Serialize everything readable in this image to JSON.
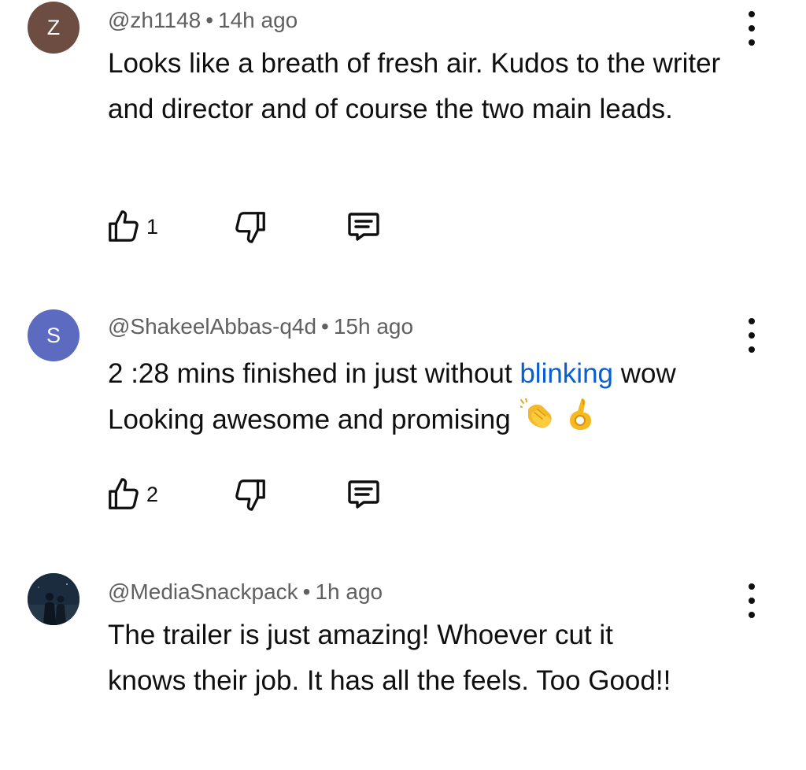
{
  "comments": [
    {
      "avatar_letter": "Z",
      "avatar_color": "#6d4c41",
      "handle": "@zh1148",
      "separator": "•",
      "time": "14h ago",
      "text": "Looks like a breath of fresh air. Kudos to the writer and director and of course the two main leads.",
      "like_count": "1"
    },
    {
      "avatar_letter": "S",
      "avatar_color": "#5c6bc0",
      "handle": "@ShakeelAbbas-q4d",
      "separator": "•",
      "time": "15h ago",
      "text_before_link": "2 :28 mins finished in just without ",
      "link_text": "blinking",
      "text_after_link": " wow Looking awesome and promising",
      "emojis": [
        "clapping-hands",
        "ok-hand"
      ],
      "like_count": "2"
    },
    {
      "avatar_letter": "",
      "avatar_color": "#1c2d3f",
      "handle": "@MediaSnackpack",
      "separator": "•",
      "time": "1h ago",
      "text": "The trailer is just amazing! Whoever cut it knows their job. It has all the feels. Too Good!!"
    }
  ],
  "icons": {
    "like": "thumbs-up-icon",
    "dislike": "thumbs-down-icon",
    "reply": "reply-comment-icon",
    "more": "vertical-dots-icon"
  },
  "colors": {
    "link": "#065fd4",
    "meta_text": "#606060",
    "body_text": "#0f0f0f"
  }
}
